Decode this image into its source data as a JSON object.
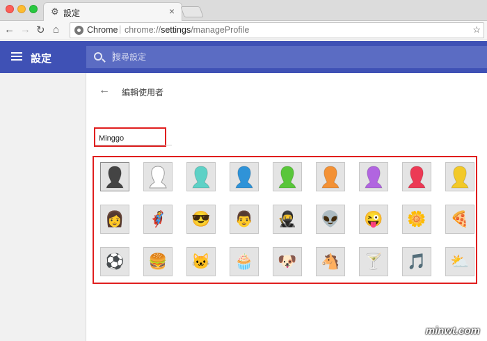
{
  "window": {
    "tab_title": "設定",
    "tab_icon": "gear-icon"
  },
  "omnibox": {
    "scheme_label": "Chrome",
    "separator": "|",
    "url_scheme": "chrome://",
    "url_host": "settings",
    "url_path": "/manageProfile"
  },
  "header": {
    "title": "設定",
    "search_placeholder": "搜尋設定"
  },
  "page": {
    "title": "編輯使用者",
    "name_value": "Minggo"
  },
  "avatars": [
    {
      "name": "avatar-generic-silhouette",
      "glyph": "",
      "color": "#444444"
    },
    {
      "name": "avatar-white",
      "glyph": "",
      "color": "#ffffff"
    },
    {
      "name": "avatar-teal",
      "glyph": "",
      "color": "#5ed1c6"
    },
    {
      "name": "avatar-blue",
      "glyph": "",
      "color": "#2f93d8"
    },
    {
      "name": "avatar-green",
      "glyph": "",
      "color": "#59c63a"
    },
    {
      "name": "avatar-orange",
      "glyph": "",
      "color": "#f39135"
    },
    {
      "name": "avatar-purple",
      "glyph": "",
      "color": "#b165e0"
    },
    {
      "name": "avatar-red",
      "glyph": "",
      "color": "#ec3a55"
    },
    {
      "name": "avatar-yellow",
      "glyph": "",
      "color": "#f2c928"
    },
    {
      "name": "avatar-blonde-woman",
      "glyph": "👩",
      "color": ""
    },
    {
      "name": "avatar-superhero",
      "glyph": "🦸",
      "color": ""
    },
    {
      "name": "avatar-woman-sunglasses",
      "glyph": "😎",
      "color": ""
    },
    {
      "name": "avatar-businessman",
      "glyph": "👨",
      "color": ""
    },
    {
      "name": "avatar-ninja",
      "glyph": "🥷",
      "color": ""
    },
    {
      "name": "avatar-alien",
      "glyph": "👽",
      "color": ""
    },
    {
      "name": "avatar-awesome-face",
      "glyph": "😜",
      "color": ""
    },
    {
      "name": "avatar-flower",
      "glyph": "🌼",
      "color": ""
    },
    {
      "name": "avatar-pizza",
      "glyph": "🍕",
      "color": ""
    },
    {
      "name": "avatar-soccer-ball",
      "glyph": "⚽",
      "color": ""
    },
    {
      "name": "avatar-burger",
      "glyph": "🍔",
      "color": ""
    },
    {
      "name": "avatar-cat",
      "glyph": "🐱",
      "color": ""
    },
    {
      "name": "avatar-cupcake",
      "glyph": "🧁",
      "color": ""
    },
    {
      "name": "avatar-dog",
      "glyph": "🐶",
      "color": ""
    },
    {
      "name": "avatar-horse",
      "glyph": "🐴",
      "color": ""
    },
    {
      "name": "avatar-cocktail",
      "glyph": "🍸",
      "color": ""
    },
    {
      "name": "avatar-music-note",
      "glyph": "🎵",
      "color": ""
    },
    {
      "name": "avatar-sun-cloud",
      "glyph": "⛅",
      "color": ""
    }
  ],
  "watermark": "minwt.com",
  "colors": {
    "header": "#3f51b5",
    "search_bar": "#5b6cc3",
    "highlight": "#e01e1e"
  }
}
